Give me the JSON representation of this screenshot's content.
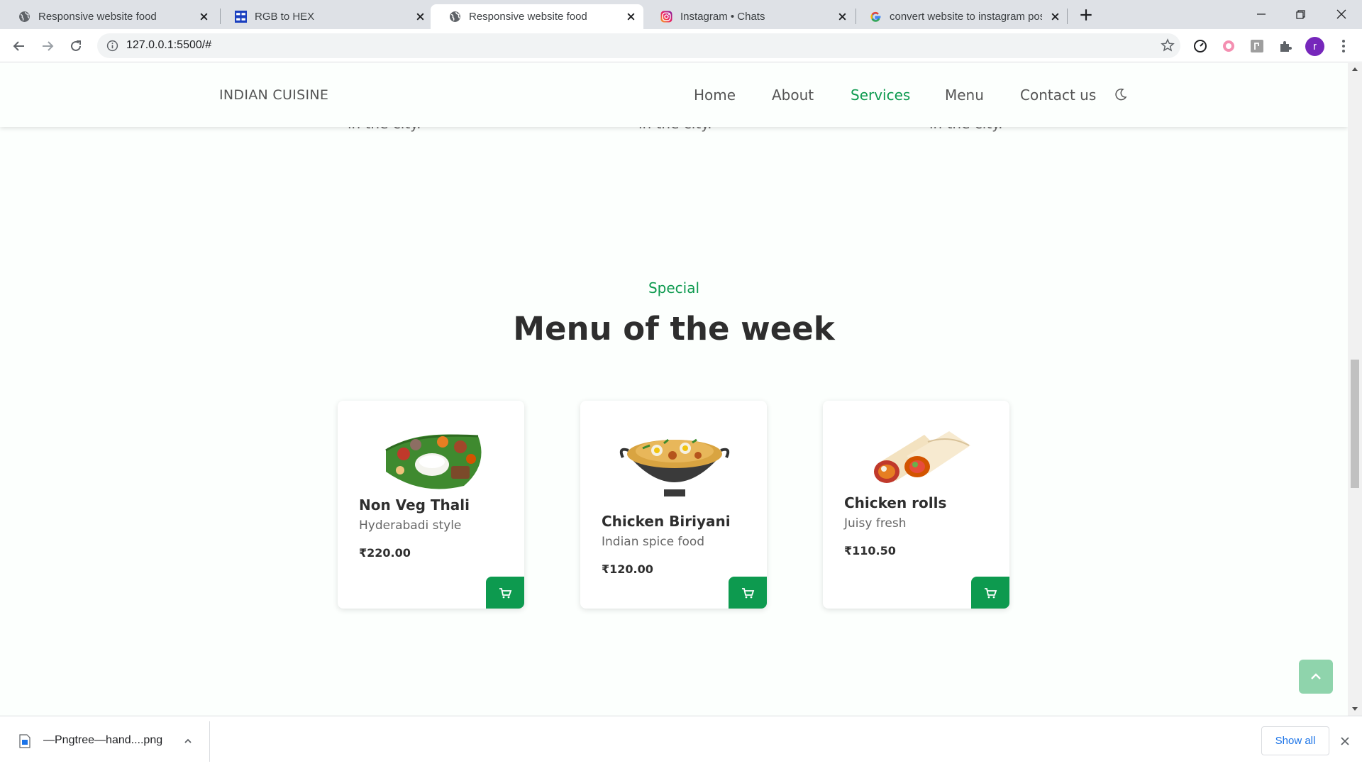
{
  "browser": {
    "tabs": [
      {
        "title": "Responsive website food",
        "icon": "globe-icon",
        "active": false
      },
      {
        "title": "RGB to HEX",
        "icon": "rgb-hex-site-icon",
        "active": false
      },
      {
        "title": "Responsive website food",
        "icon": "globe-icon",
        "active": true
      },
      {
        "title": "Instagram • Chats",
        "icon": "instagram-icon",
        "active": false
      },
      {
        "title": "convert website to instagram pos",
        "icon": "google-icon",
        "active": false
      }
    ],
    "url": "127.0.0.1:5500/#",
    "profile_initial": "r"
  },
  "site": {
    "logo": "INDIAN CUISINE",
    "nav": {
      "home": "Home",
      "about": "About",
      "services": "Services",
      "menu": "Menu",
      "contact": "Contact us"
    },
    "active_nav": "Services",
    "peek_text": [
      "in the city.",
      "in the city.",
      "in the city."
    ],
    "section": {
      "subtitle": "Special",
      "title": "Menu of the week"
    },
    "cards": [
      {
        "name": "Non Veg Thali",
        "desc": "Hyderabadi style",
        "price": "₹220.00",
        "image": "thali-image"
      },
      {
        "name": "Chicken Biriyani",
        "desc": "Indian spice food",
        "price": "₹120.00",
        "image": "biriyani-image"
      },
      {
        "name": "Chicken rolls",
        "desc": "Juisy fresh",
        "price": "₹110.50",
        "image": "rolls-image"
      }
    ]
  },
  "downloads": {
    "file_name": "—Pngtree—hand....png",
    "show_all": "Show all"
  },
  "colors": {
    "accent": "#0d9a4f",
    "scrollup_bg": "#8fd4ac",
    "profile": "#7627bb",
    "link_blue": "#1a73e8"
  }
}
